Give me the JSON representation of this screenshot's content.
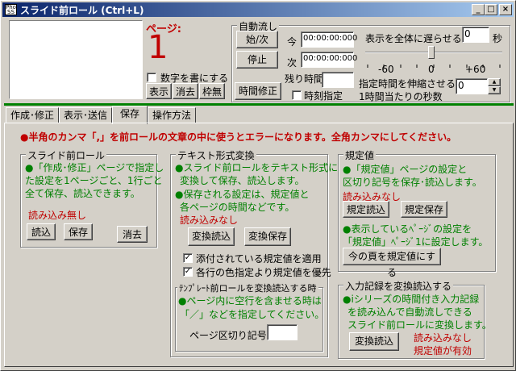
{
  "window": {
    "app_icon_text": "Pho\nSS",
    "title": "スライド前ロール (Ctrl+L)",
    "controls": {
      "minimize": "_",
      "maximize": "□",
      "close": "×"
    }
  },
  "top": {
    "page_label": "ページ:",
    "page_number": "1",
    "number_checkbox_label": "数字を書にする",
    "btn_show": "表示",
    "btn_erase": "消去",
    "btn_border": "枠無"
  },
  "auto": {
    "group_label": "自動流し",
    "btn_start_next": "始/次",
    "btn_stop": "停止",
    "btn_time_fix": "時間修正",
    "now_label": "今",
    "now_value": "00:00:00:000",
    "next_label": "次",
    "next_value": "00:00:00:000",
    "remaining_label": "残り時間",
    "remaining_value": "",
    "time_specify_label": "時刻指定",
    "delay_label": "表示を全体に遅らせる",
    "delay_value": "0",
    "delay_unit": "秒",
    "slider_min": "-60",
    "slider_mid": "0",
    "slider_max": "+60",
    "slider_value": 0,
    "stretch_label_1": "指定時間を伸縮させる",
    "stretch_label_2": "1時間当たりの秒数",
    "stretch_value": "0"
  },
  "tabs": [
    "作成･修正",
    "表示･送信",
    "保存",
    "操作方法"
  ],
  "active_tab": 2,
  "warning": "●半角のカンマ「,」を前ロールの文章の中に使うとエラーになります。全角カンマにしてください。",
  "slide": {
    "group_label": "スライド前ロール",
    "desc_1": "●「作成･修正」ページで指定し",
    "desc_2": "た設定を1ページごと、1行ごと",
    "desc_3": "全て保存、読込できます。",
    "status": "読み込み無し",
    "btn_load": "読込",
    "btn_save": "保存",
    "btn_erase": "消去"
  },
  "text_conv": {
    "group_label": "テキスト形式変換",
    "desc_1": "●スライド前ロールをテキスト形式に",
    "desc_2": "変換して保存、読込します。",
    "desc_3": "●保存される設定は、規定値と",
    "desc_4": "各ページの時間などです。",
    "status": "読み込みなし",
    "btn_conv_load": "変換読込",
    "btn_conv_save": "変換保存",
    "chk1_label": "添付されている規定値を適用",
    "chk1": "✓",
    "chk2_label": "各行の色指定より規定値を優先",
    "chk2": "✓"
  },
  "template": {
    "group_label": "ﾃﾝﾌﾟﾚｰﾄ前ロールを変換読込する時",
    "desc_1": "●ページ内に空行を含ませる時は",
    "desc_2": "「／」などを指定してください。",
    "sep_label": "ページ区切り記号",
    "sep_value": ""
  },
  "defaults": {
    "group_label": "規定値",
    "desc_1": "●「規定値」ページの設定と",
    "desc_2": "区切り記号を保存･読込します。",
    "status": "読み込みなし",
    "btn_load": "規定読込",
    "btn_save": "規定保存",
    "desc_3": "●表示しているﾍﾟｰｼﾞの設定を",
    "desc_4": "「規定値」ﾍﾟｰｼﾞ1に設定します。",
    "btn_apply": "今の頁を規定値にする"
  },
  "input_rec": {
    "group_label": "入力記録を変換読込する",
    "desc_1": "●iシリーズの時間付き入力記録",
    "desc_2": "を読み込んで自動流しできる",
    "desc_3": "スライド前ロールに変換します。",
    "btn_conv": "変換読込",
    "status_1": "読み込みなし",
    "status_2": "規定値が有効"
  }
}
